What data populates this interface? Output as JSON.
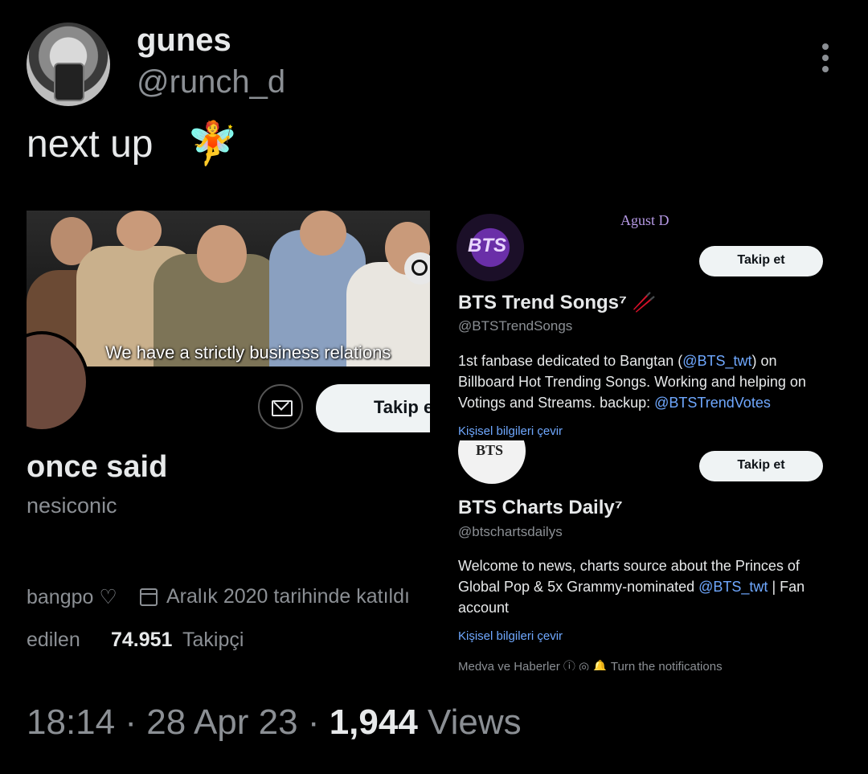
{
  "tweet": {
    "author_name": "gunes",
    "author_handle": "@runch_d",
    "text": "next up",
    "emoji": "🧚",
    "time": "18:14",
    "separator1": " · ",
    "date": "28 Apr 23",
    "separator2": " · ",
    "views_count": "1,944",
    "views_label": " Views"
  },
  "left_card": {
    "banner_caption": "We have a strictly business relations",
    "follow_label": "Takip e",
    "name": "once said",
    "handle": "nesiconic",
    "location": "bangpo ♡",
    "joined": "Aralık 2020 tarihinde katıldı",
    "following_label": "edilen",
    "followers_count": "74.951",
    "followers_label": "Takipçi"
  },
  "right_cards": [
    {
      "banner_text": "Agust D",
      "logo_text": "BTS",
      "follow_label": "Takip et",
      "name": "BTS Trend Songs⁷ 🥢",
      "handle": "@BTSTrendSongs",
      "bio_a": "1st fanbase dedicated to Bangtan (",
      "bio_link1": "@BTS_twt",
      "bio_b": ") on Billboard Hot Trending Songs. Working and helping on Votings and Streams. backup: ",
      "bio_link2": "@BTSTrendVotes",
      "translate": "Kişisel bilgileri çevir"
    },
    {
      "logo_text": "BTS",
      "follow_label": "Takip et",
      "name": "BTS Charts Daily⁷",
      "handle": "@btschartsdailys",
      "bio_a": "Welcome to news, charts source about the Princes of Global Pop & 5x Grammy-nominated ",
      "bio_link1": "@BTS_twt",
      "bio_b": " | Fan account",
      "translate": "Kişisel bilgileri çevir",
      "meta": "Medya ve Haberler ⓘ   ◎ 🔔 Turn the notifications"
    }
  ],
  "colors": {
    "background": "#000000",
    "text": "#e7e9ea",
    "secondary": "#8b8f94",
    "link": "#6fa8ff"
  }
}
